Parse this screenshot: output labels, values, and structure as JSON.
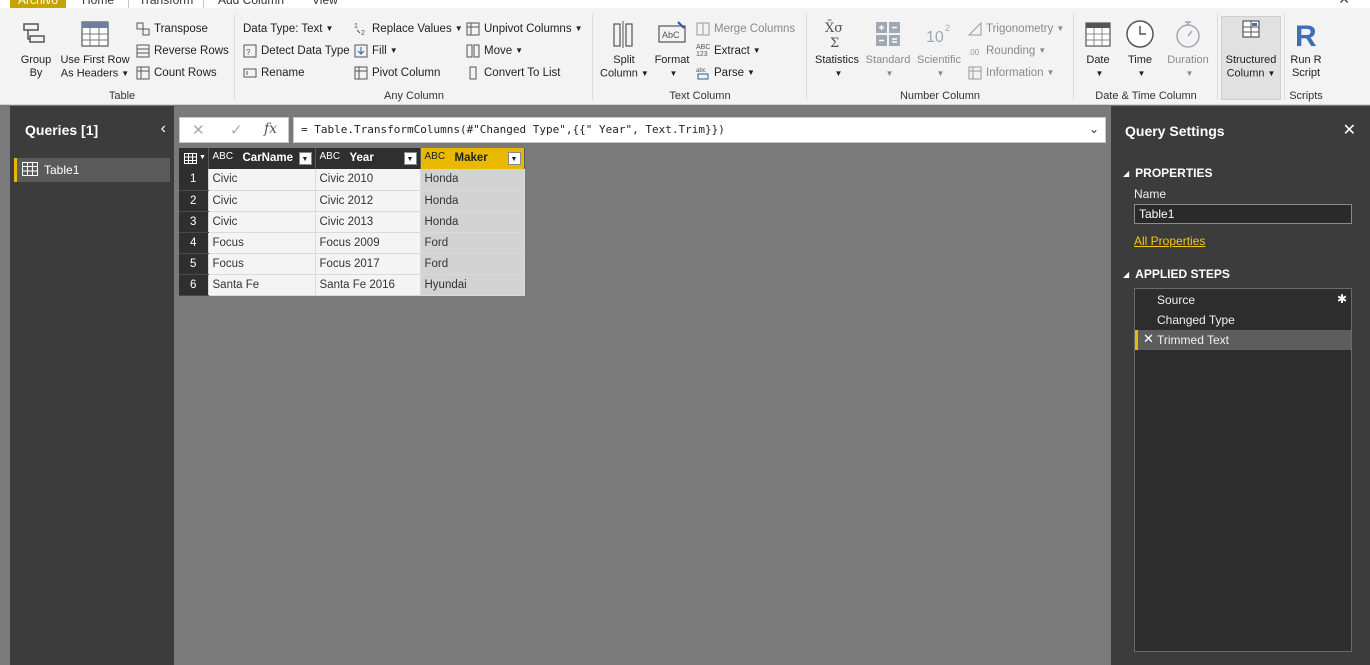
{
  "tabs": {
    "file": "Archivo",
    "home": "Home",
    "transform": "Transform",
    "add_column": "Add Column",
    "view": "View"
  },
  "ribbon": {
    "table": {
      "label": "Table",
      "group_by": [
        "Group",
        "By"
      ],
      "use_first_row": [
        "Use First Row",
        "As Headers"
      ],
      "transpose": "Transpose",
      "reverse_rows": "Reverse Rows",
      "count_rows": "Count Rows"
    },
    "any_column": {
      "label": "Any Column",
      "data_type": "Data Type: Text",
      "detect_data_type": "Detect Data Type",
      "rename": "Rename",
      "replace_values": "Replace Values",
      "fill": "Fill",
      "pivot_column": "Pivot Column",
      "unpivot_columns": "Unpivot Columns",
      "move": "Move",
      "convert_to_list": "Convert To List"
    },
    "text_column": {
      "label": "Text Column",
      "split_column": [
        "Split",
        "Column"
      ],
      "format": "Format",
      "merge_columns": "Merge Columns",
      "extract": "Extract",
      "parse": "Parse"
    },
    "number_column": {
      "label": "Number Column",
      "statistics": "Statistics",
      "standard": "Standard",
      "scientific": "Scientific",
      "trigonometry": "Trigonometry",
      "rounding": "Rounding",
      "information": "Information"
    },
    "date_time": {
      "label": "Date & Time Column",
      "date": "Date",
      "time": "Time",
      "duration": "Duration"
    },
    "structured": {
      "label": "",
      "structured_column": [
        "Structured",
        "Column"
      ]
    },
    "scripts": {
      "label": "Scripts",
      "run_r": [
        "Run R",
        "Script"
      ]
    }
  },
  "queries": {
    "title": "Queries [1]",
    "items": [
      "Table1"
    ]
  },
  "formula": {
    "text": "= Table.TransformColumns(#\"Changed Type\",{{\" Year\", Text.Trim}})"
  },
  "grid": {
    "columns": [
      {
        "type": "ABC",
        "name": "CarName"
      },
      {
        "type": "ABC",
        "name": "Year"
      },
      {
        "type": "ABC",
        "name": "Maker"
      }
    ],
    "rows": [
      [
        "1",
        "Civic",
        "Civic 2010",
        "Honda"
      ],
      [
        "2",
        "Civic",
        "Civic 2012",
        "Honda"
      ],
      [
        "3",
        "Civic",
        "Civic 2013",
        "Honda"
      ],
      [
        "4",
        "Focus",
        "Focus 2009",
        "Ford"
      ],
      [
        "5",
        "Focus",
        "Focus 2017",
        "Ford"
      ],
      [
        "6",
        "Santa Fe",
        "Santa Fe 2016",
        "Hyundai"
      ]
    ]
  },
  "settings": {
    "title": "Query Settings",
    "properties_title": "PROPERTIES",
    "name_label": "Name",
    "name_value": "Table1",
    "all_properties": "All Properties",
    "steps_title": "APPLIED STEPS",
    "steps": [
      "Source",
      "Changed Type",
      "Trimmed Text"
    ]
  },
  "colors": {
    "accent": "#e8b900",
    "pane_dark": "#3c3c3c",
    "canvas": "#7a7a7a"
  }
}
